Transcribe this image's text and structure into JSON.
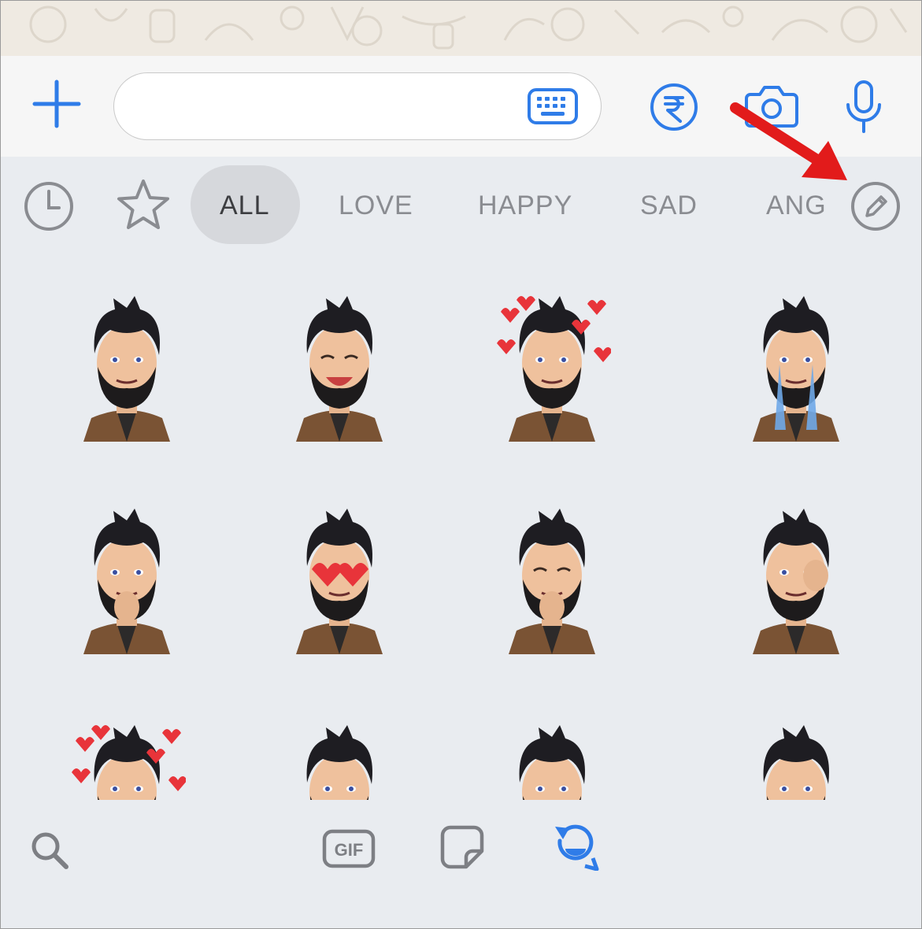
{
  "composer": {
    "message_value": "",
    "placeholder": ""
  },
  "icons": {
    "add": "plus-icon",
    "keyboard": "keyboard-icon",
    "payment": "rupee-icon",
    "camera": "camera-icon",
    "microphone": "microphone-icon",
    "recent": "clock-icon",
    "favorites": "star-icon",
    "edit": "pencil-icon",
    "search": "search-icon",
    "gif": "gif-icon",
    "stickers": "sticker-icon",
    "avatar": "avatar-icon"
  },
  "categories": [
    {
      "label": "ALL",
      "active": true
    },
    {
      "label": "LOVE",
      "active": false
    },
    {
      "label": "HAPPY",
      "active": false
    },
    {
      "label": "SAD",
      "active": false
    },
    {
      "label": "ANG",
      "active": false
    }
  ],
  "bottom_bar": {
    "gif_label": "GIF"
  },
  "stickers": [
    "wink",
    "laughing",
    "love-hearts",
    "crying",
    "thinking",
    "heart-eyes",
    "giggling",
    "facepalm",
    "sad-hearts",
    "angry",
    "smiling",
    "surprised"
  ],
  "colors": {
    "accent": "#2f7ce8",
    "tab_text": "#8a8c91",
    "tab_active_text": "#3c3d40",
    "active_pill": "#d6d8dc",
    "panel_bg": "#e9ecf0",
    "annotation_arrow": "#e21b1b"
  }
}
